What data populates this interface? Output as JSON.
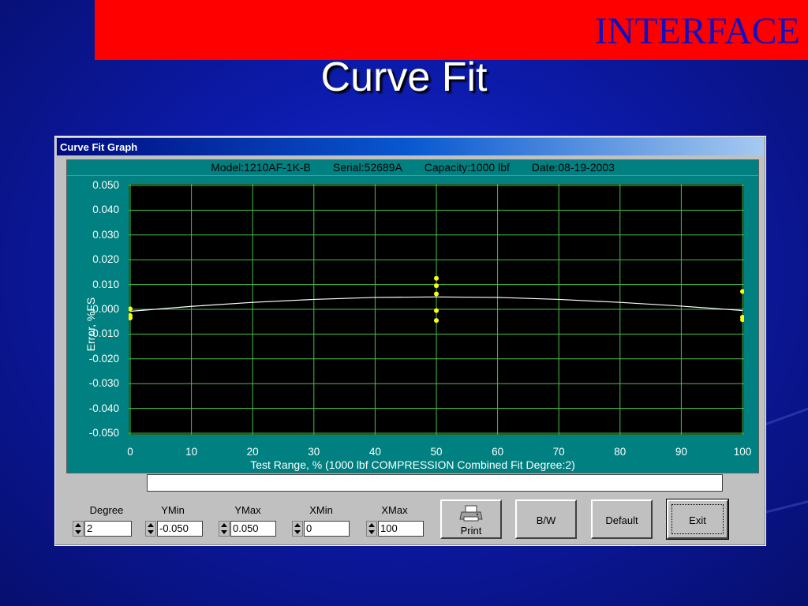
{
  "banner": {
    "text": "INTERFACE",
    "color": "#ff0000"
  },
  "slide_title": "Curve Fit",
  "window": {
    "title": "Curve Fit Graph",
    "header": {
      "model": "Model:1210AF-1K-B",
      "serial": "Serial:52689A",
      "capacity": "Capacity:1000 lbf",
      "date": "Date:08-19-2003"
    },
    "status_text": "",
    "controls": {
      "degree": {
        "label": "Degree",
        "value": "2"
      },
      "ymin": {
        "label": "YMin",
        "value": "-0.050"
      },
      "ymax": {
        "label": "YMax",
        "value": "0.050"
      },
      "xmin": {
        "label": "XMin",
        "value": "0"
      },
      "xmax": {
        "label": "XMax",
        "value": "100"
      }
    },
    "buttons": {
      "print": "Print",
      "bw": "B/W",
      "default": "Default",
      "exit": "Exit"
    }
  },
  "chart_data": {
    "type": "scatter",
    "xlabel": "Test Range, % (1000 lbf COMPRESSION Combined Fit Degree:2)",
    "ylabel": "Error, %FS",
    "xlim": [
      0,
      100
    ],
    "ylim": [
      -0.05,
      0.05
    ],
    "x_ticks": [
      "0",
      "10",
      "20",
      "30",
      "40",
      "50",
      "60",
      "70",
      "80",
      "90",
      "100"
    ],
    "y_ticks": [
      "0.050",
      "0.040",
      "0.030",
      "0.020",
      "0.010",
      "0.000",
      "-0.010",
      "-0.020",
      "-0.030",
      "-0.040",
      "-0.050"
    ],
    "grid": true,
    "series": [
      {
        "type": "scatter",
        "color": "#ffff00",
        "points": [
          [
            0,
            0.0002
          ],
          [
            0,
            -0.0025
          ],
          [
            0,
            -0.0035
          ],
          [
            50,
            0.0125
          ],
          [
            50,
            0.0095
          ],
          [
            50,
            0.0062
          ],
          [
            50,
            -0.0005
          ],
          [
            50,
            -0.0045
          ],
          [
            100,
            0.0072
          ],
          [
            100,
            -0.0032
          ],
          [
            100,
            -0.0042
          ]
        ]
      },
      {
        "type": "line",
        "color": "#ffffff",
        "points": [
          [
            0,
            -0.0008
          ],
          [
            10,
            0.0012
          ],
          [
            20,
            0.0028
          ],
          [
            30,
            0.004
          ],
          [
            40,
            0.0048
          ],
          [
            50,
            0.005
          ],
          [
            60,
            0.0048
          ],
          [
            70,
            0.004
          ],
          [
            80,
            0.0028
          ],
          [
            90,
            0.0013
          ],
          [
            100,
            -0.0005
          ]
        ]
      }
    ]
  }
}
